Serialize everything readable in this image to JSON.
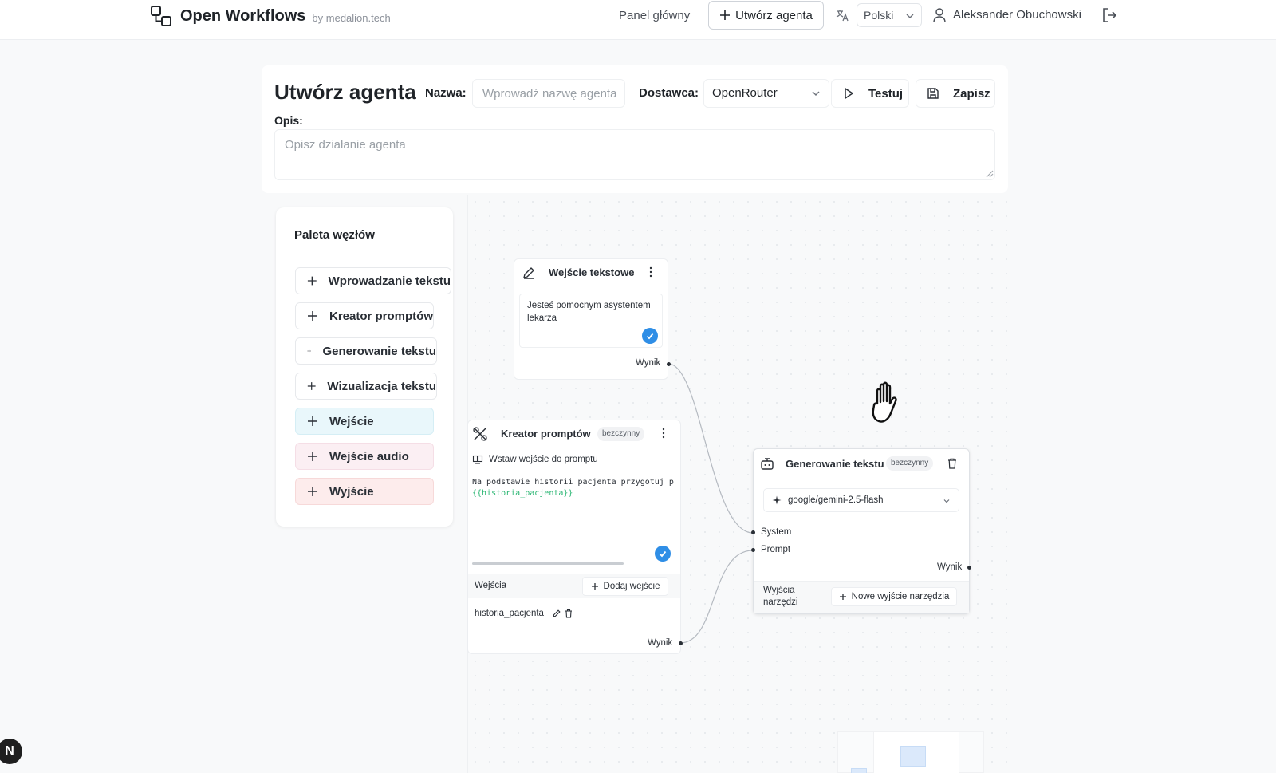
{
  "brand": {
    "name": "Open Workflows",
    "by": "by medalion.tech"
  },
  "nav": {
    "dashboard": "Panel główny",
    "create_agent": "Utwórz agenta",
    "language": "Polski",
    "user": "Aleksander Obuchowski"
  },
  "form": {
    "title": "Utwórz agenta",
    "name_label": "Nazwa:",
    "name_placeholder": "Wprowadź nazwę agenta",
    "provider_label": "Dostawca:",
    "provider_value": "OpenRouter",
    "test_label": "Testuj",
    "save_label": "Zapisz",
    "description_label": "Opis:",
    "description_placeholder": "Opisz działanie agenta"
  },
  "palette": {
    "title": "Paleta węzłów",
    "items": [
      {
        "label": "Wprowadzanie tekstu"
      },
      {
        "label": "Kreator promptów"
      },
      {
        "label": "Generowanie tekstu"
      },
      {
        "label": "Wizualizacja tekstu"
      },
      {
        "label": "Wejście"
      },
      {
        "label": "Wejście audio"
      },
      {
        "label": "Wyjście"
      }
    ]
  },
  "nodes": {
    "text_input": {
      "title": "Wejście tekstowe",
      "content_line1": "Jesteś pomocnym asystentem",
      "content_line2": "lekarza",
      "output_label": "Wynik"
    },
    "prompt_builder": {
      "title": "Kreator promptów",
      "status": "bezczynny",
      "insert_label": "Wstaw wejście do promptu",
      "prompt_text": "Na podstawie historii pacjenta przygotuj p",
      "prompt_var": "{{historia_pacjenta}}",
      "inputs_label": "Wejścia",
      "add_input_label": "Dodaj wejście",
      "input_name": "historia_pacjenta",
      "output_label": "Wynik"
    },
    "text_generation": {
      "title": "Generowanie tekstu",
      "status": "bezczynny",
      "model": "google/gemini-2.5-flash",
      "system_label": "System",
      "prompt_label": "Prompt",
      "output_label": "Wynik",
      "tool_outputs_line1": "Wyjścia",
      "tool_outputs_line2": "narzędzi",
      "new_tool_output_label": "Nowe wyjście narzędzia"
    }
  },
  "misc": {
    "next_badge": "N"
  },
  "colors": {
    "accent_blue": "#2f8ee6",
    "variable_green": "#2bb673",
    "palette_input_bg": "#e9f7fb",
    "palette_audio_bg": "#fbeff3",
    "palette_output_bg": "#fdecec"
  }
}
